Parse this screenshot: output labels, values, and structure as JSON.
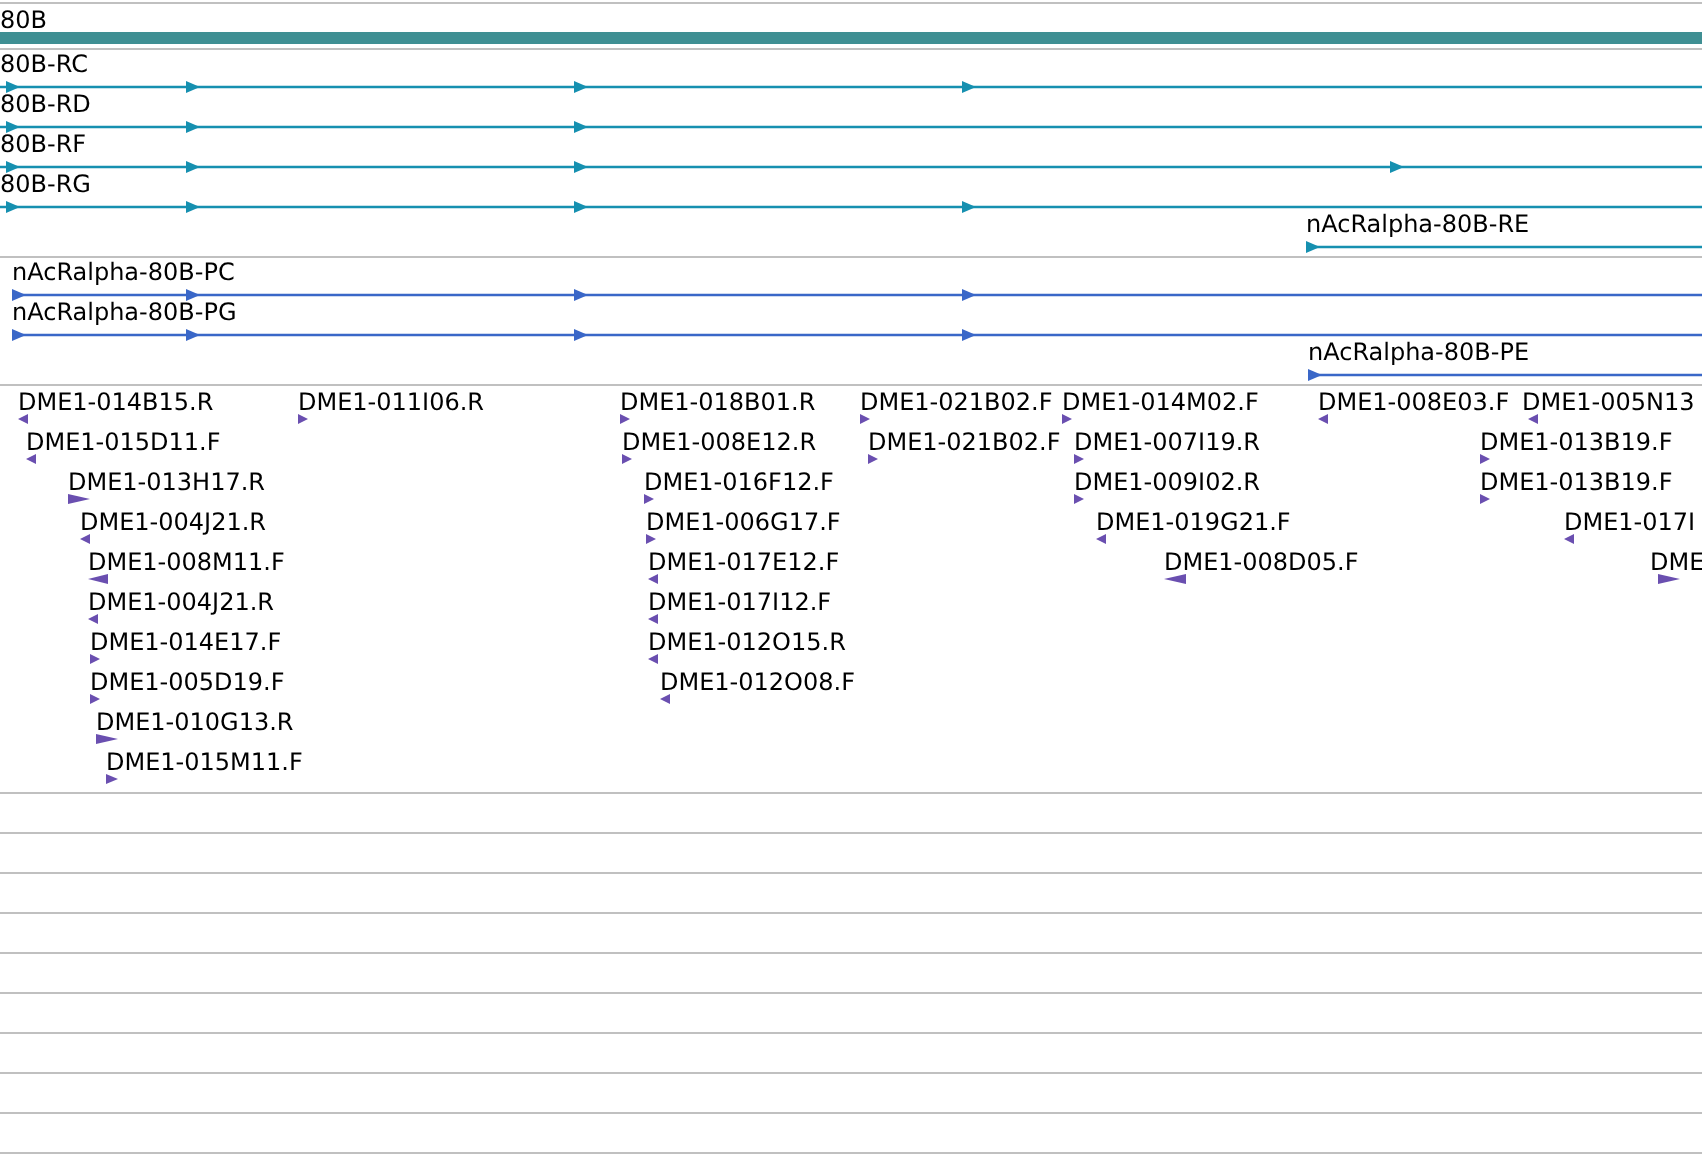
{
  "gene_track": {
    "label": "80B"
  },
  "transcripts": [
    {
      "label": "80B-RC"
    },
    {
      "label": "80B-RD"
    },
    {
      "label": "80B-RF"
    },
    {
      "label": "80B-RG"
    },
    {
      "label": "nAcRalpha-80B-RE"
    }
  ],
  "proteins": [
    {
      "label": "nAcRalpha-80B-PC"
    },
    {
      "label": "nAcRalpha-80B-PG"
    },
    {
      "label": "nAcRalpha-80B-PE"
    }
  ],
  "ests": [
    {
      "label": "DME1-014B15.R",
      "reverse": true
    },
    {
      "label": "DME1-015D11.F",
      "reverse": true
    },
    {
      "label": "DME1-013H17.R",
      "reverse": false
    },
    {
      "label": "DME1-004J21.R",
      "reverse": true
    },
    {
      "label": "DME1-008M11.F",
      "reverse": true
    },
    {
      "label": "DME1-004J21.R",
      "reverse": true
    },
    {
      "label": "DME1-014E17.F",
      "reverse": false
    },
    {
      "label": "DME1-005D19.F",
      "reverse": false
    },
    {
      "label": "DME1-010G13.R",
      "reverse": false
    },
    {
      "label": "DME1-015M11.F",
      "reverse": false
    },
    {
      "label": "DME1-011I06.R",
      "reverse": false
    },
    {
      "label": "DME1-018B01.R",
      "reverse": false
    },
    {
      "label": "DME1-008E12.R",
      "reverse": false
    },
    {
      "label": "DME1-016F12.F",
      "reverse": false
    },
    {
      "label": "DME1-006G17.F",
      "reverse": false
    },
    {
      "label": "DME1-017E12.F",
      "reverse": true
    },
    {
      "label": "DME1-017I12.F",
      "reverse": true
    },
    {
      "label": "DME1-012O15.R",
      "reverse": true
    },
    {
      "label": "DME1-012O08.F",
      "reverse": true
    },
    {
      "label": "DME1-021B02.F",
      "reverse": false
    },
    {
      "label": "DME1-021B02.F",
      "reverse": false
    },
    {
      "label": "DME1-014M02.F",
      "reverse": false
    },
    {
      "label": "DME1-007I19.R",
      "reverse": false
    },
    {
      "label": "DME1-009I02.R",
      "reverse": false
    },
    {
      "label": "DME1-019G21.F",
      "reverse": true
    },
    {
      "label": "DME1-008D05.F",
      "reverse": true
    },
    {
      "label": "DME1-008E03.F",
      "reverse": true
    },
    {
      "label": "DME1-005N13",
      "reverse": true
    },
    {
      "label": "DME1-013B19.F",
      "reverse": false
    },
    {
      "label": "DME1-013B19.F",
      "reverse": false
    },
    {
      "label": "DME1-017I",
      "reverse": true
    },
    {
      "label": "DME",
      "reverse": false
    }
  ]
}
